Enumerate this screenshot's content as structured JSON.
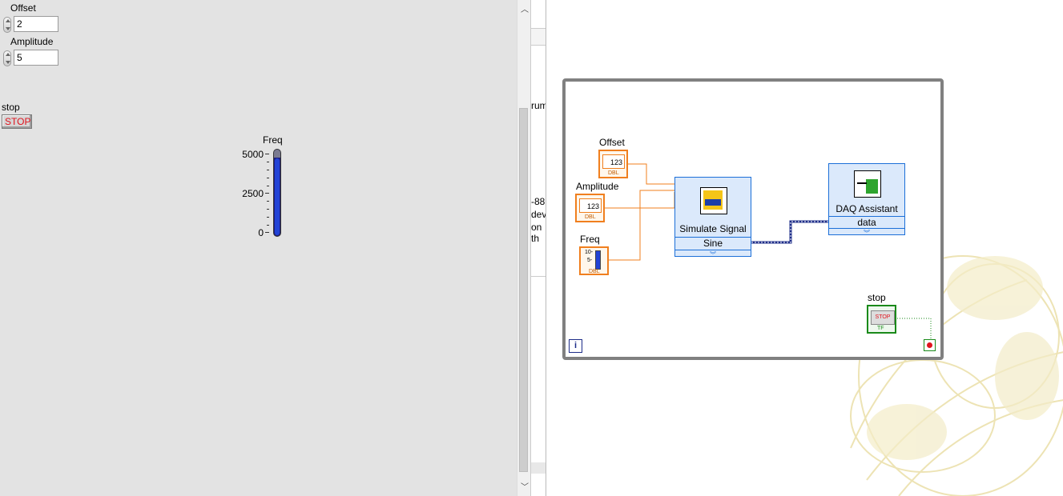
{
  "front_panel": {
    "offset": {
      "label": "Offset",
      "value": "2"
    },
    "amplitude": {
      "label": "Amplitude",
      "value": "5"
    },
    "stop": {
      "label": "stop",
      "button_text": "STOP"
    },
    "freq_slider": {
      "label": "Freq",
      "ticks": [
        "5000",
        "2500",
        "0"
      ],
      "level_fraction": 1.0,
      "fill_color": "#2243d6"
    }
  },
  "background_text": {
    "line1": "rum",
    "line2": "-88",
    "line3": "dev",
    "line4": "on th"
  },
  "block_diagram": {
    "offset_terminal": {
      "label": "Offset",
      "glyph": "123",
      "type": "DBL"
    },
    "amplitude_terminal": {
      "label": "Amplitude",
      "glyph": "123",
      "type": "DBL"
    },
    "freq_terminal": {
      "label": "Freq",
      "tick_hi": "10-",
      "tick_mid": "5-",
      "type": "DBL"
    },
    "simulate_signal": {
      "title": "Simulate Signal",
      "output": "Sine"
    },
    "daq_assistant": {
      "title": "DAQ Assistant",
      "input": "data"
    },
    "stop_terminal": {
      "label": "stop",
      "glyph": "STOP",
      "type": "TF"
    },
    "iteration_terminal": "i",
    "colors": {
      "numeric_wire": "#f07f1e",
      "loop_border": "#808080",
      "boolean": "#1a8a1a",
      "express_vi": "#dbe9fb"
    }
  }
}
